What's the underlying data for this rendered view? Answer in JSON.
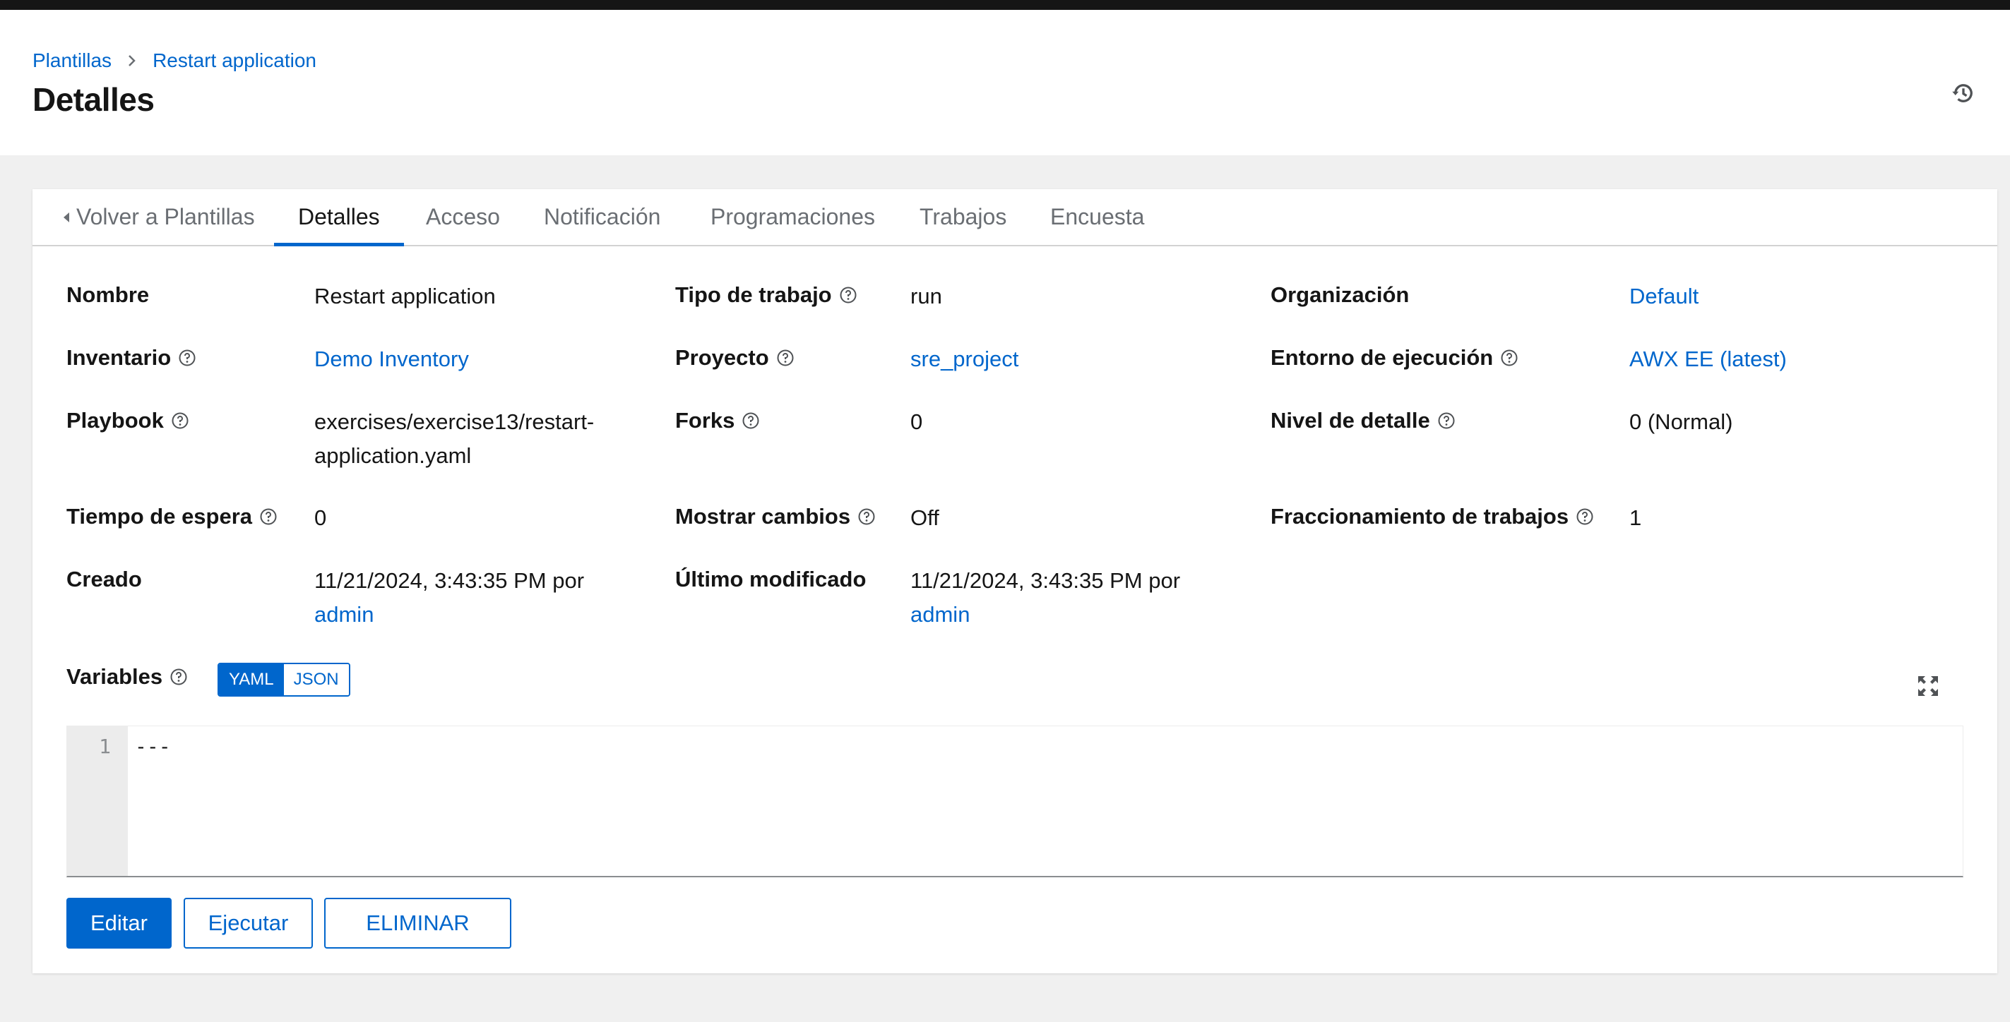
{
  "breadcrumb": {
    "parent": "Plantillas",
    "current": "Restart application"
  },
  "page_title": "Detalles",
  "icons": {
    "history": "history-icon",
    "help": "question-circle-icon",
    "back": "caret-left-icon",
    "expand": "expand-icon"
  },
  "tabs": [
    {
      "label": "Volver a Plantillas"
    },
    {
      "label": "Detalles",
      "active": true
    },
    {
      "label": "Acceso"
    },
    {
      "label": "Notificación"
    },
    {
      "label": "Programaciones"
    },
    {
      "label": "Trabajos"
    },
    {
      "label": "Encuesta"
    }
  ],
  "details": {
    "name": {
      "label": "Nombre",
      "value": "Restart application"
    },
    "job_type": {
      "label": "Tipo de trabajo",
      "value": "run"
    },
    "organization": {
      "label": "Organización",
      "value": "Default"
    },
    "inventory": {
      "label": "Inventario",
      "value": "Demo Inventory"
    },
    "project": {
      "label": "Proyecto",
      "value": "sre_project"
    },
    "execution_env": {
      "label": "Entorno de ejecución",
      "value": "AWX EE (latest)"
    },
    "playbook": {
      "label": "Playbook",
      "value_line1": "exercises/exercise13/restart-",
      "value_line2": "application.yaml"
    },
    "forks": {
      "label": "Forks",
      "value": "0"
    },
    "verbosity": {
      "label": "Nivel de detalle",
      "value": "0 (Normal)"
    },
    "timeout": {
      "label": "Tiempo de espera",
      "value": "0"
    },
    "show_changes": {
      "label": "Mostrar cambios",
      "value": "Off"
    },
    "job_slicing": {
      "label": "Fraccionamiento de trabajos",
      "value": "1"
    },
    "created": {
      "label": "Creado",
      "date": "11/21/2024, 3:43:35 PM por",
      "user": "admin"
    },
    "modified": {
      "label": "Último modificado",
      "date": "11/21/2024, 3:43:35 PM por",
      "user": "admin"
    }
  },
  "variables": {
    "label": "Variables",
    "toggle": {
      "yaml": "YAML",
      "json": "JSON",
      "selected": "YAML"
    },
    "editor": {
      "line_number": "1",
      "content": "---"
    }
  },
  "buttons": {
    "edit": "Editar",
    "launch": "Ejecutar",
    "delete": "ELIMINAR"
  },
  "colors": {
    "link": "#0066cc",
    "primary": "#0066cc",
    "text": "#151515",
    "muted": "#6a6e73",
    "page_bg": "#f0f0f0"
  }
}
